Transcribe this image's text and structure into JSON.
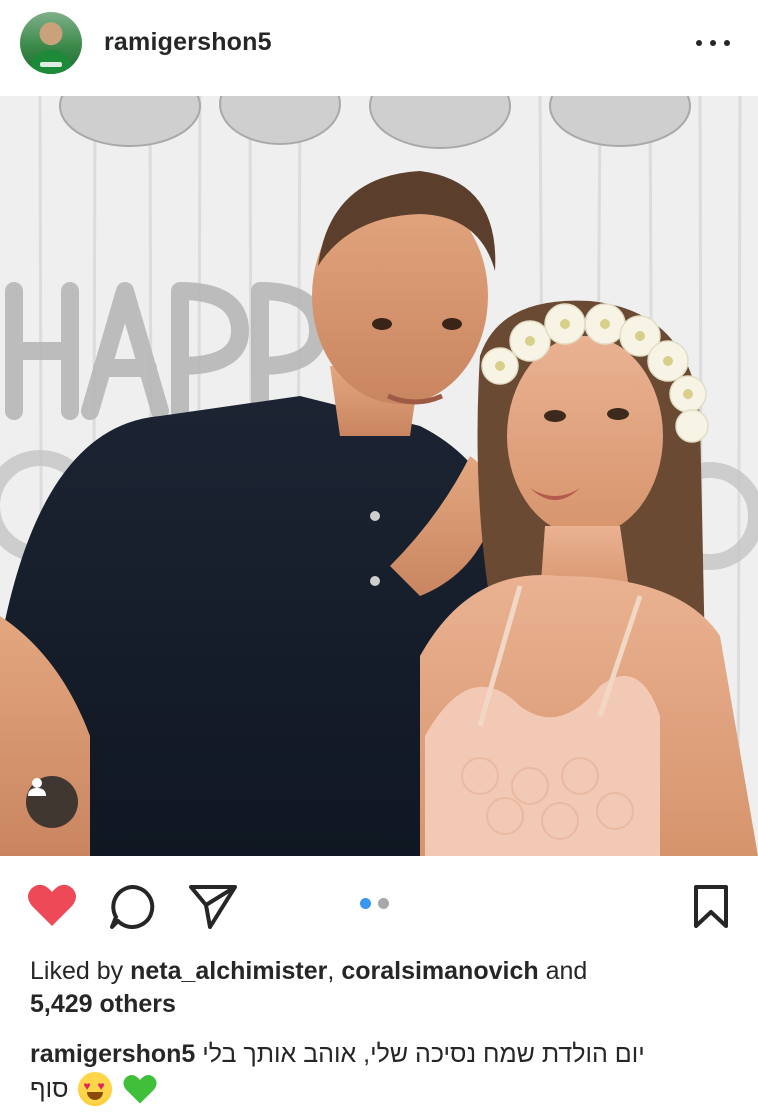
{
  "post": {
    "username": "ramigershon5",
    "avatar_icon": "profile-avatar",
    "more_icon": "more-horizontal-icon"
  },
  "photo": {
    "balloon_text": "HAPP",
    "tag_icon": "person-tag-icon"
  },
  "actions": {
    "like_icon": "heart-icon",
    "liked": true,
    "like_color": "#ed4956",
    "comment_icon": "comment-icon",
    "share_icon": "send-icon",
    "save_icon": "bookmark-icon",
    "carousel_count": 2,
    "carousel_active": 1,
    "carousel_active_color": "#3897f0"
  },
  "likes": {
    "prefix": "Liked by",
    "user1": "neta_alchimister",
    "separator": ",",
    "user2": "coralsimanovich",
    "connector": "and",
    "others": "5,429 others"
  },
  "caption": {
    "username": "ramigershon5",
    "text_line1": "יום הולדת שמח נסיכה שלי, אוהב אותך בלי",
    "text_line2": "סוף",
    "emojis": [
      "heart-eyes-emoji",
      "green-heart-emoji"
    ]
  }
}
